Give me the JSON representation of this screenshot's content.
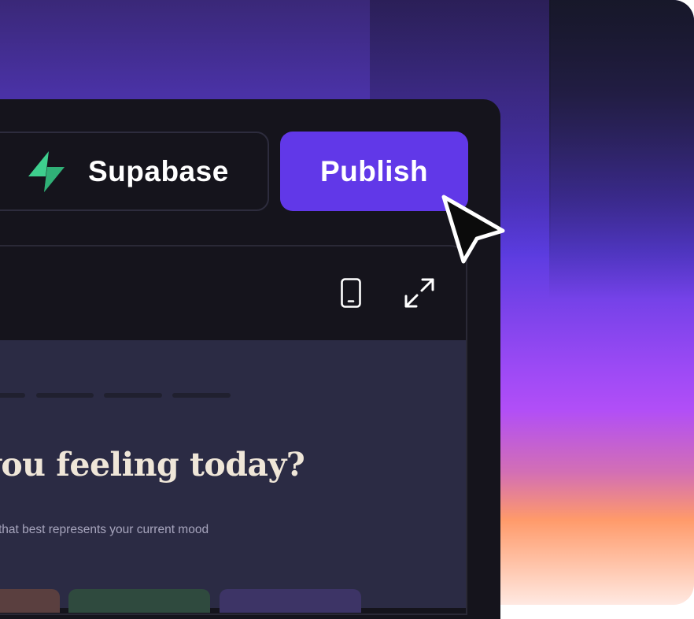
{
  "toolbar": {
    "integration_label": "Supabase",
    "publish_label": "Publish"
  },
  "preview": {
    "heading": "you feeling today?",
    "subtitle": "that best represents your current mood"
  },
  "colors": {
    "publish_button": "#6138e8",
    "supabase_green": "#3ecf8e",
    "panel_background": "#15141c",
    "preview_background": "#2b2b44",
    "heading_text": "#efe6d8"
  },
  "mood_options": [
    {
      "color": "#5a3f3f"
    },
    {
      "color": "#2f4a3e"
    },
    {
      "color": "#3d3466"
    }
  ]
}
